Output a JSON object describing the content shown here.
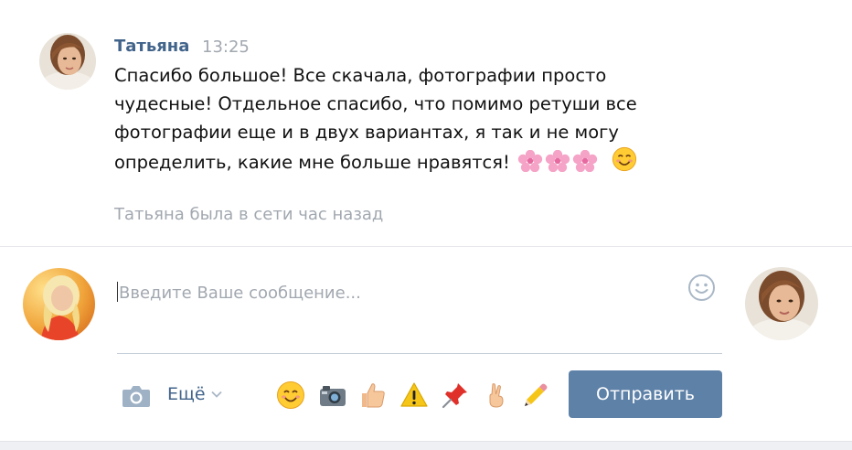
{
  "message": {
    "author": "Татьяна",
    "time": "13:25",
    "lines": [
      "Спасибо большое! Все скачала, фотографии просто",
      "чудесные! Отдельное спасибо, что помимо ретуши все",
      "фотографии еще и в двух вариантах, я так и не могу",
      "определить, какие мне больше нравятся!"
    ],
    "trailing_emoji": [
      "cherry-blossom-icon",
      "cherry-blossom-icon",
      "cherry-blossom-icon",
      "smiling-face-icon"
    ]
  },
  "status": {
    "text": "Татьяна была в сети час назад"
  },
  "composer": {
    "placeholder": "Введите Ваше сообщение...",
    "value": "",
    "more_label": "Ещё",
    "send_label": "Отправить",
    "quick_emoji": [
      "smiling-face-icon",
      "camera-icon",
      "thumbs-up-icon",
      "warning-icon",
      "pushpin-icon",
      "victory-hand-icon",
      "pencil-icon"
    ]
  },
  "colors": {
    "link": "#42648b",
    "muted": "#a2a8b0",
    "send_button": "#5e81a8",
    "divider": "#e7e8ec",
    "underline": "#c5d0db"
  }
}
